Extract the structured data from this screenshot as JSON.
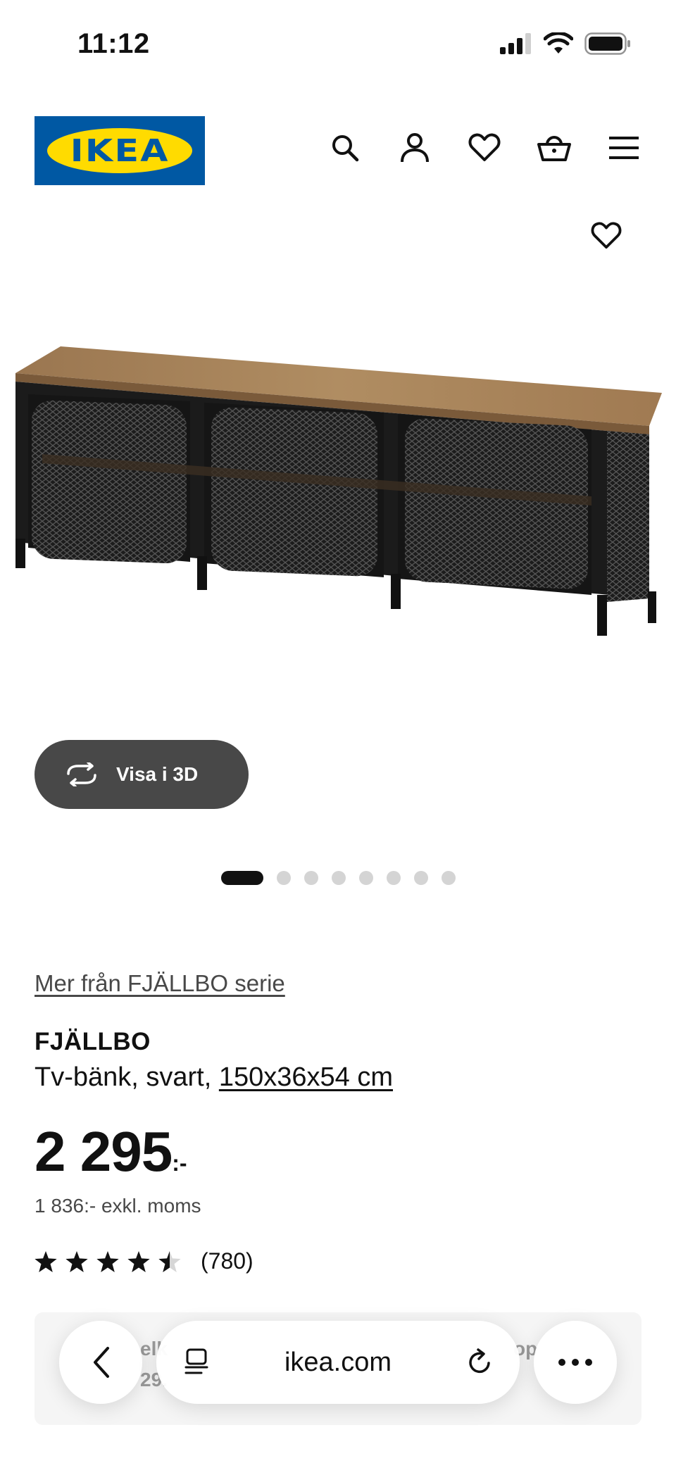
{
  "status_bar": {
    "time": "11:12",
    "icons": [
      "signal-icon",
      "wifi-icon",
      "battery-icon"
    ]
  },
  "header": {
    "logo_text": "IKEA",
    "icons": [
      "search-icon",
      "profile-icon",
      "heart-icon",
      "basket-icon",
      "menu-icon"
    ]
  },
  "colors": {
    "brand_blue": "#0058a3",
    "brand_yellow": "#ffdb00",
    "button_dark": "#484848",
    "text": "#111111"
  },
  "product": {
    "view3d_label": "Visa i 3D",
    "series_link": "Mer från FJÄLLBO serie",
    "name": "FJÄLLBO",
    "description": "Tv-bänk, svart,",
    "size": "150x36x54 cm",
    "price": "2 295",
    "price_suffix": ":-",
    "price_excl": "1 836:- exkl. moms",
    "rating_value": 4.5,
    "review_count": "(780)"
  },
  "carousel": {
    "total": 8,
    "active_index": 0
  },
  "bottom_card": {
    "left_fragment_1": "elk",
    "left_fragment_2": "29.",
    "right_fragment": "op"
  },
  "browser": {
    "url": "ikea.com"
  }
}
